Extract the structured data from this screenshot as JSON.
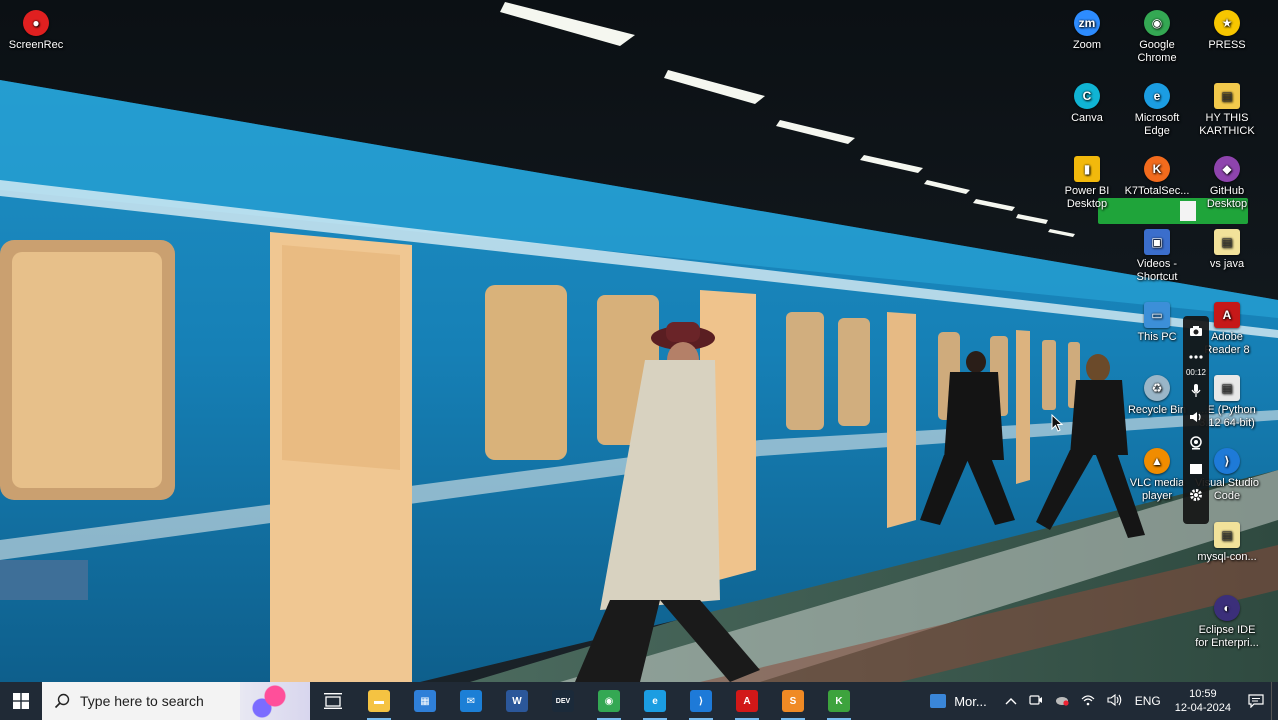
{
  "desktop_icons": [
    {
      "id": "screenrec",
      "label": "ScreenRec",
      "icon": "record-icon",
      "color": "#e02020"
    },
    {
      "id": "zoom",
      "label": "Zoom",
      "icon": "zoom-icon",
      "color": "#2d8cff"
    },
    {
      "id": "chrome",
      "label": "Google\nChrome",
      "icon": "chrome-icon",
      "color": "#34a853"
    },
    {
      "id": "press",
      "label": "PRESS",
      "icon": "star-icon",
      "color": "#f7c600"
    },
    {
      "id": "canva",
      "label": "Canva",
      "icon": "canva-icon",
      "color": "#10b4d4"
    },
    {
      "id": "edge",
      "label": "Microsoft\nEdge",
      "icon": "edge-icon",
      "color": "#1b9de2"
    },
    {
      "id": "hythis",
      "label": "HY THIS\nKARTHICK",
      "icon": "file-icon",
      "color": "#f2c94c"
    },
    {
      "id": "powerbi",
      "label": "Power BI\nDesktop",
      "icon": "powerbi-icon",
      "color": "#f2b90c"
    },
    {
      "id": "k7",
      "label": "K7TotalSec...",
      "icon": "k7-icon",
      "color": "#f26b1d"
    },
    {
      "id": "github",
      "label": "GitHub\nDesktop",
      "icon": "github-icon",
      "color": "#8e44ad"
    },
    {
      "id": "videos",
      "label": "Videos -\nShortcut",
      "icon": "folder-icon",
      "color": "#3b6ecc"
    },
    {
      "id": "vsjava",
      "label": "vs java",
      "icon": "file-icon",
      "color": "#f2e29a"
    },
    {
      "id": "thispc",
      "label": "This PC",
      "icon": "pc-icon",
      "color": "#3c8fd8"
    },
    {
      "id": "adobe",
      "label": "Adobe\nReader 8",
      "icon": "pdf-icon",
      "color": "#c61818"
    },
    {
      "id": "recycle",
      "label": "Recycle Bin",
      "icon": "recycle-bin-icon",
      "color": "#9ab6c8"
    },
    {
      "id": "python",
      "label": "...E (Python\n3.12 64-bit)",
      "icon": "python-file-icon",
      "color": "#e8e8e8"
    },
    {
      "id": "vlc",
      "label": "VLC media\nplayer",
      "icon": "vlc-icon",
      "color": "#f08c00"
    },
    {
      "id": "vscode",
      "label": "Visual Studio\nCode",
      "icon": "vscode-icon",
      "color": "#1e7ad8"
    },
    {
      "id": "mysql",
      "label": "mysql-con...",
      "icon": "file-icon",
      "color": "#f2e29a"
    },
    {
      "id": "eclipse",
      "label": "Eclipse IDE\nfor Enterpri...",
      "icon": "eclipse-icon",
      "color": "#3b2f7a"
    }
  ],
  "recorder_toolbar": {
    "timer": "00:12",
    "buttons": [
      "camera-icon",
      "more-icon",
      "microphone-icon",
      "speaker-icon",
      "webcam-icon",
      "window-icon",
      "settings-icon"
    ]
  },
  "taskbar": {
    "search_placeholder": "Type here to search",
    "apps": [
      "file-explorer-icon",
      "store-icon",
      "mail-icon",
      "word-icon",
      "dev-icon",
      "chrome-icon",
      "edge-icon",
      "vscode-icon",
      "acrobat-icon",
      "sublime-icon",
      "k7-icon"
    ],
    "news_text": "Mor...",
    "tray": {
      "language": "ENG",
      "time": "10:59",
      "date": "12-04-2024"
    }
  }
}
